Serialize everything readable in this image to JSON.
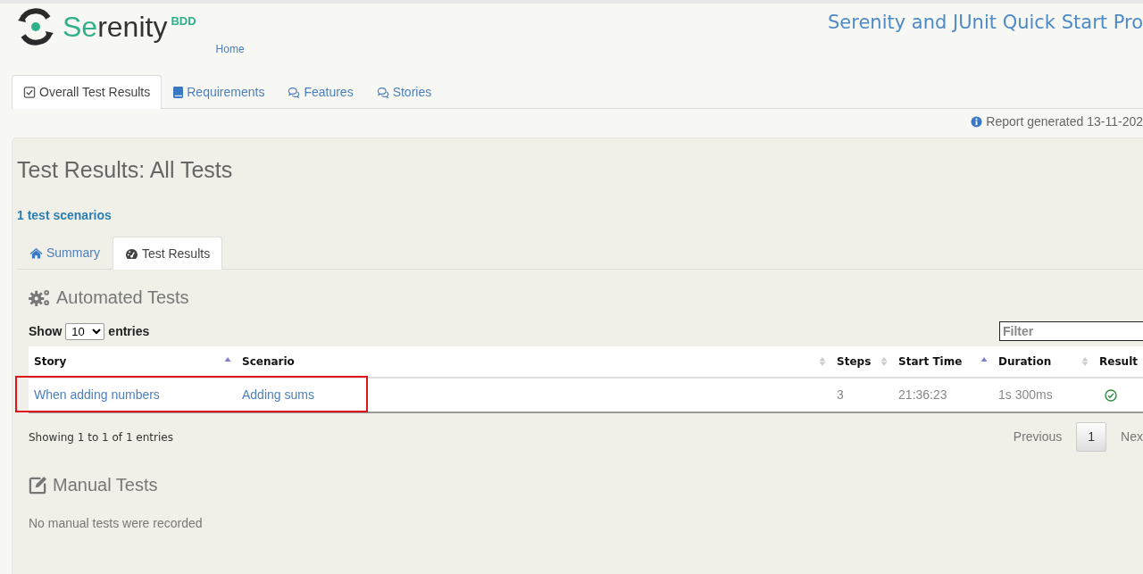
{
  "brand": {
    "name_accent": "Se",
    "name_rest": "renity",
    "suffix": "BDD"
  },
  "home_link": "Home",
  "project_title": "Serenity and JUnit Quick Start Pro",
  "main_tabs": [
    {
      "label": "Overall Test Results",
      "selected": true
    },
    {
      "label": "Requirements",
      "selected": false
    },
    {
      "label": "Features",
      "selected": false
    },
    {
      "label": "Stories",
      "selected": false
    }
  ],
  "report_generated": "Report generated 13-11-202",
  "page_title": "Test Results: All Tests",
  "scenario_count": "1 test scenarios",
  "sub_tabs": [
    {
      "label": "Summary",
      "selected": false
    },
    {
      "label": "Test Results",
      "selected": true
    }
  ],
  "automated": {
    "heading": "Automated Tests",
    "show_label": "Show",
    "page_size": "10",
    "entries_label": "entries",
    "filter_placeholder": "Filter",
    "columns": [
      {
        "label": "Story",
        "sorted": true
      },
      {
        "label": "Scenario",
        "sorted": false
      },
      {
        "label": "Steps",
        "sorted": false
      },
      {
        "label": "Start Time",
        "sorted": true
      },
      {
        "label": "Duration",
        "sorted": false
      },
      {
        "label": "Result"
      }
    ],
    "rows": [
      {
        "story": "When adding numbers",
        "scenario": "Adding sums",
        "steps": "3",
        "start_time": "21:36:23",
        "duration": "1s 300ms",
        "passed": true,
        "highlighted": true
      }
    ],
    "info": "Showing 1 to 1 of 1 entries",
    "pagination": {
      "previous": "Previous",
      "pages": [
        {
          "label": "1",
          "selected": true
        }
      ],
      "next": "Nex"
    }
  },
  "manual": {
    "heading": "Manual Tests",
    "message": "No manual tests were recorded"
  }
}
